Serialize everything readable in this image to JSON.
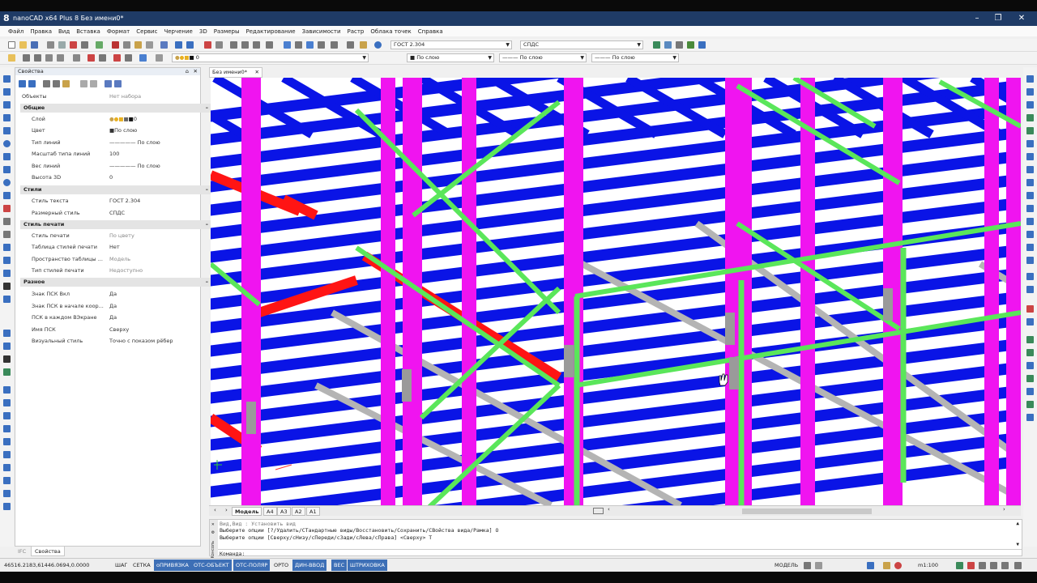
{
  "window": {
    "title": "nanoCAD x64 Plus 8 Без имени0*",
    "app_icon": "8"
  },
  "menu": [
    "Файл",
    "Правка",
    "Вид",
    "Вставка",
    "Формат",
    "Сервис",
    "Черчение",
    "3D",
    "Размеры",
    "Редактирование",
    "Зависимости",
    "Растр",
    "Облака точек",
    "Справка"
  ],
  "toolbar": {
    "text_style": "ГОСТ 2.304",
    "dim_style": "СПДС",
    "layer": "0",
    "color": "По слою",
    "linetype": "По слою",
    "lineweight": "По слою"
  },
  "properties": {
    "title": "Свойства",
    "selection_label": "Объекты",
    "selection_value": "Нет набора",
    "sections": [
      {
        "name": "Общие",
        "rows": [
          {
            "name": "Слой",
            "value": "0"
          },
          {
            "name": "Цвет",
            "value": "По слою"
          },
          {
            "name": "Тип линий",
            "value": "По слою"
          },
          {
            "name": "Масштаб типа линий",
            "value": "100"
          },
          {
            "name": "Вес линий",
            "value": "По слою"
          },
          {
            "name": "Высота 3D",
            "value": "0"
          }
        ]
      },
      {
        "name": "Стили",
        "rows": [
          {
            "name": "Стиль текста",
            "value": "ГОСТ 2.304"
          },
          {
            "name": "Размерный стиль",
            "value": "СПДС"
          }
        ]
      },
      {
        "name": "Стиль печати",
        "rows": [
          {
            "name": "Стиль печати",
            "value": "По цвету"
          },
          {
            "name": "Таблица стилей печати",
            "value": "Нет"
          },
          {
            "name": "Пространство таблицы ...",
            "value": "Модель"
          },
          {
            "name": "Тип стилей печати",
            "value": "Недоступно"
          }
        ]
      },
      {
        "name": "Разное",
        "rows": [
          {
            "name": "Знак ПСК Вкл",
            "value": "Да"
          },
          {
            "name": "Знак ПСК в начале коор...",
            "value": "Да"
          },
          {
            "name": "ПСК в каждом ВЭкране",
            "value": "Да"
          },
          {
            "name": "Имя ПСК",
            "value": "Сверху"
          },
          {
            "name": "Визуальный стиль",
            "value": "Точно с показом рёбер"
          }
        ]
      }
    ]
  },
  "document_tab": "Без имени0*",
  "layout_tabs": [
    "Модель",
    "A4",
    "A3",
    "A2",
    "A1"
  ],
  "command": {
    "lines": [
      "Вид,Вид : Установить вид",
      "Выберите опции [?/Удалить/СТандартные виды/Восстановить/Сохранить/СВойства вида/Рамка] О",
      "Выберите опции [Сверху/сНизу/сПереди/сЗади/сЛева/сПрава] <Сверху> Т"
    ],
    "prompt": "Команда:",
    "side_label": "Консоль"
  },
  "bottom_tabs": [
    "IFC",
    "Свойства"
  ],
  "status": {
    "coords": "46516.2183,61446.0694,0.0000",
    "toggles": [
      {
        "label": "ШАГ",
        "on": false
      },
      {
        "label": "СЕТКА",
        "on": false
      },
      {
        "label": "оПРИВЯЗКА",
        "on": true
      },
      {
        "label": "ОТС-ОБЪЕКТ",
        "on": true
      },
      {
        "label": "ОТС-ПОЛЯР",
        "on": true
      },
      {
        "label": "ОРТО",
        "on": false
      },
      {
        "label": "ДИН-ВВОД",
        "on": true
      },
      {
        "label": "ВЕС",
        "on": true
      },
      {
        "label": "ШТРИХОВКА",
        "on": true
      }
    ],
    "space": "МОДЕЛЬ",
    "scale": "m1:100"
  },
  "colors": {
    "beam_blue": "#0a14e6",
    "column_magenta": "#f014f0",
    "brace_green": "#5ae65a",
    "red_beam": "#ff1414",
    "gray_beam": "#b4b4b4",
    "titlebar": "#1f3b66",
    "status_on": "#3d6fb6"
  }
}
